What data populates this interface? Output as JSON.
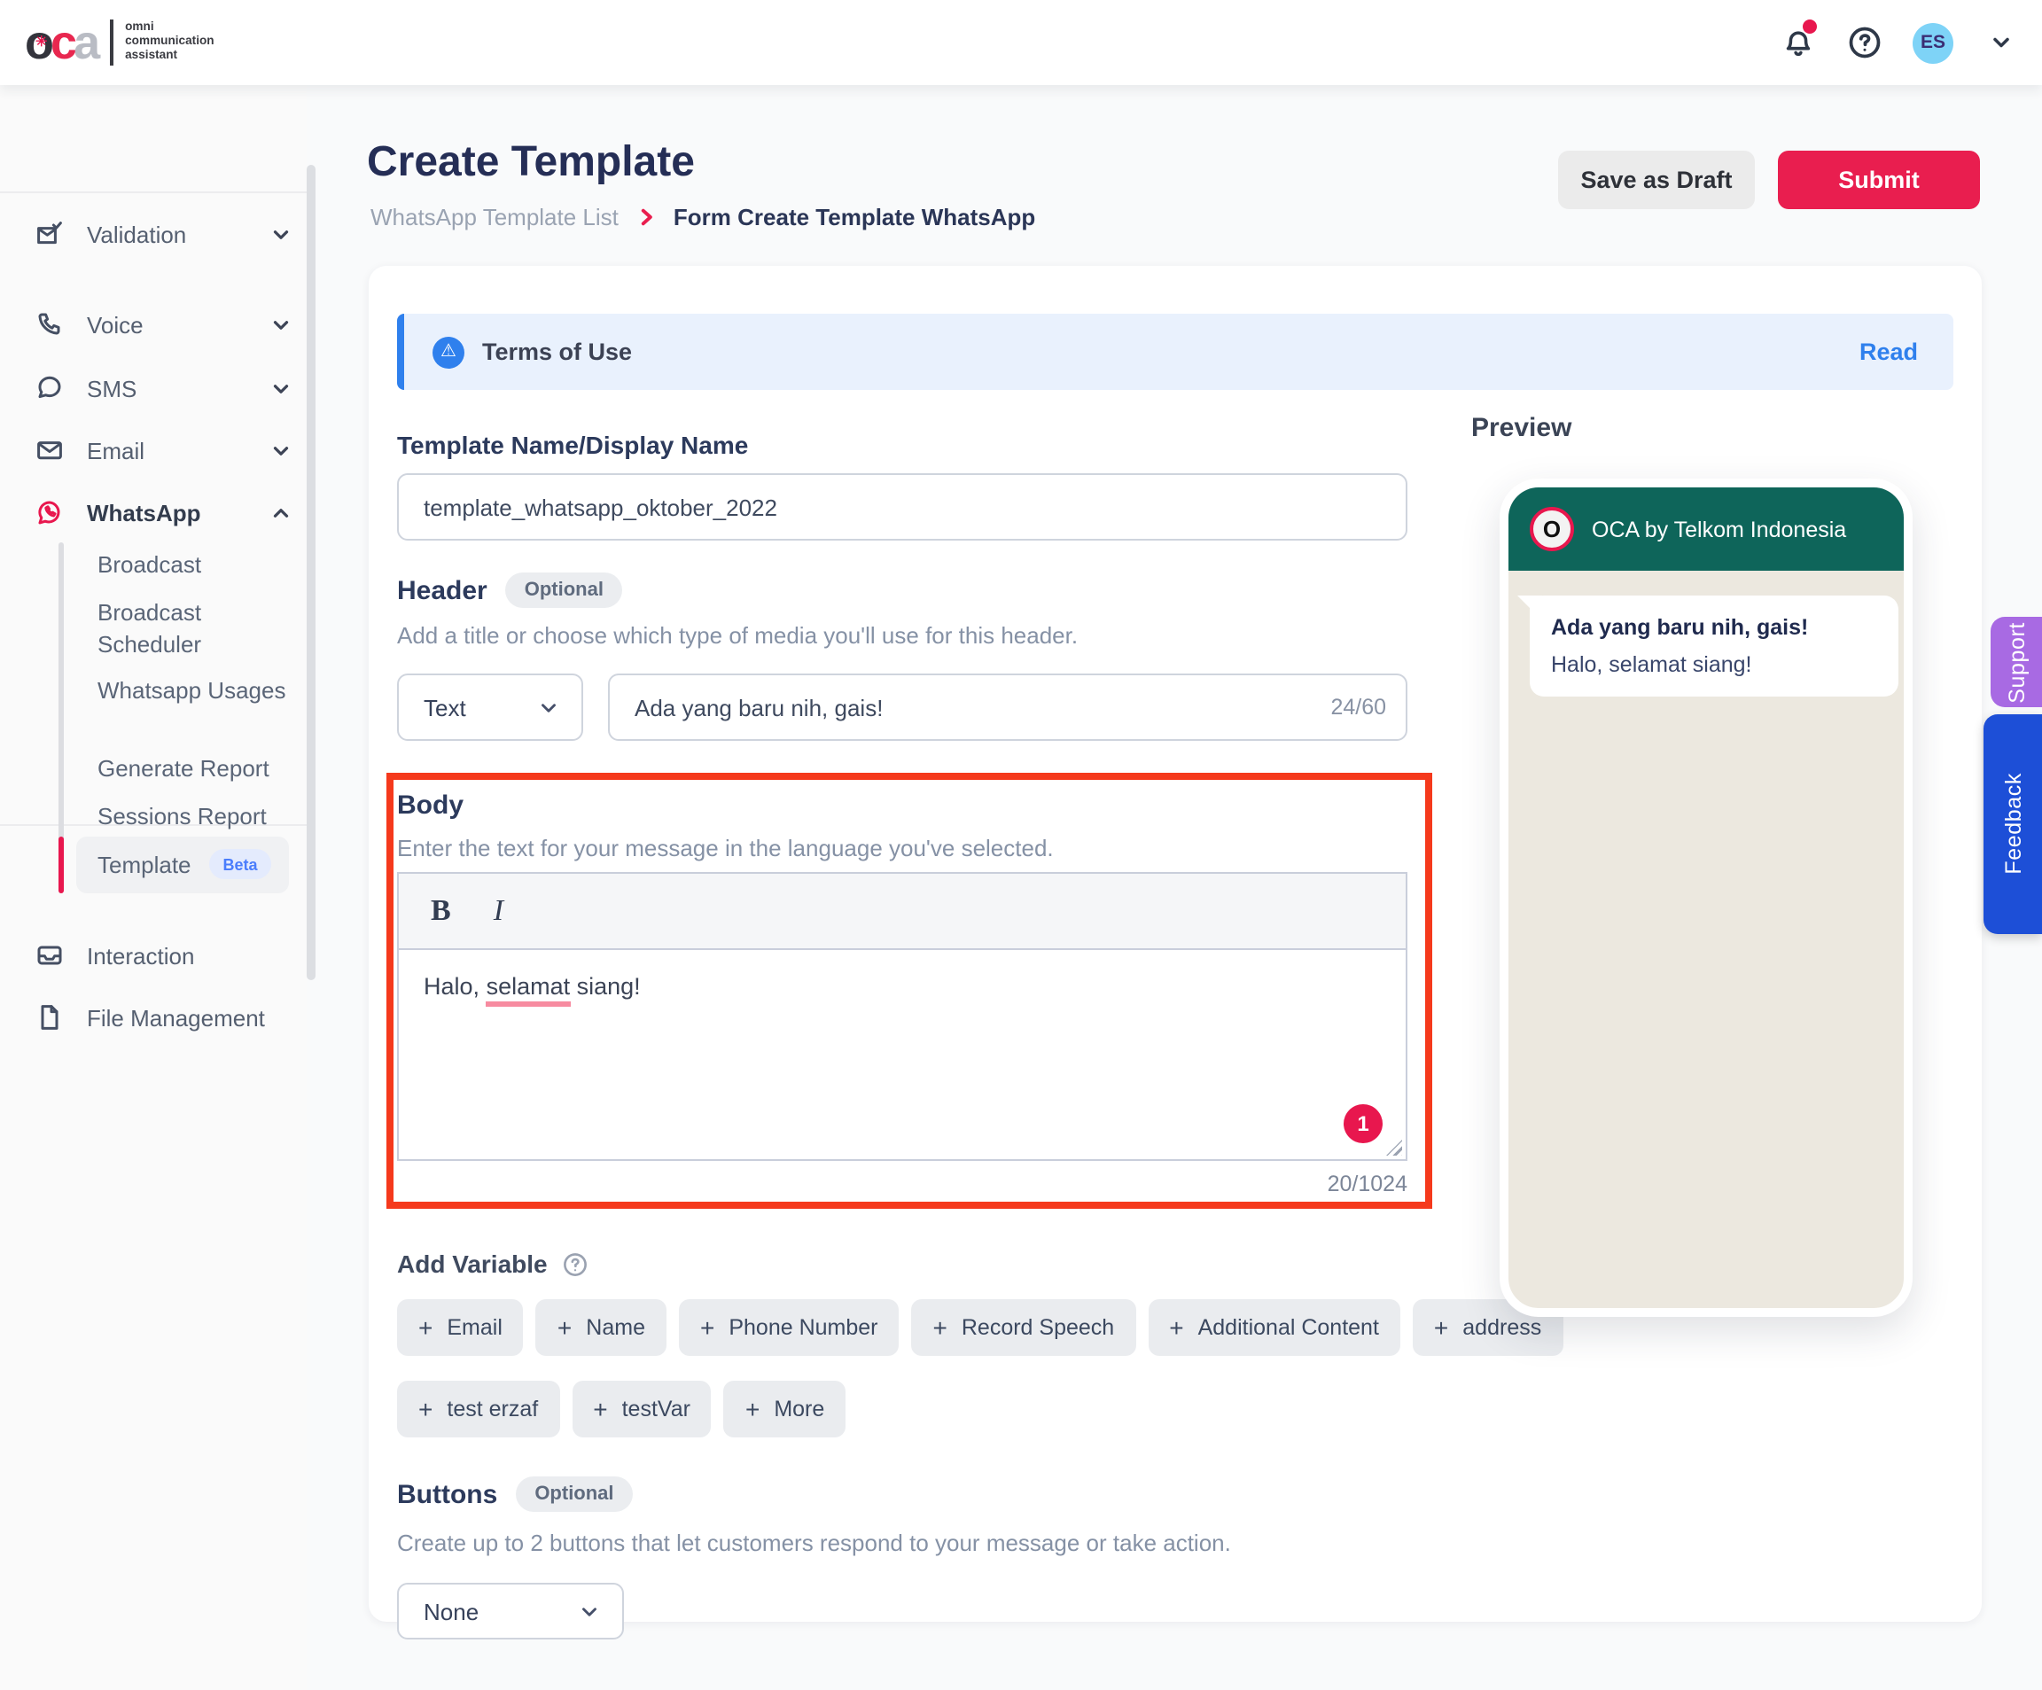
{
  "topbar": {
    "logo_word": {
      "o": "o",
      "c": "c",
      "a": "a"
    },
    "logo_tagline": [
      "omni",
      "communication",
      "assistant"
    ],
    "avatar_initials": "ES"
  },
  "sidebar": {
    "items": [
      {
        "label": "Validation"
      },
      {
        "label": "Voice"
      },
      {
        "label": "SMS"
      },
      {
        "label": "Email"
      },
      {
        "label": "WhatsApp"
      },
      {
        "label": "Interaction"
      },
      {
        "label": "File Management"
      }
    ],
    "whatsapp_children": [
      {
        "label": "Broadcast"
      },
      {
        "label": "Broadcast Scheduler"
      },
      {
        "label": "Whatsapp Usages"
      },
      {
        "label": "Generate Report"
      },
      {
        "label": "Sessions Report"
      },
      {
        "label": "Template"
      }
    ],
    "beta_badge": "Beta"
  },
  "page": {
    "title": "Create Template",
    "breadcrumb_parent": "WhatsApp Template List",
    "breadcrumb_current": "Form Create Template WhatsApp",
    "save_draft_label": "Save as Draft",
    "submit_label": "Submit"
  },
  "terms": {
    "label": "Terms of Use",
    "action": "Read",
    "icon_glyph": "⚠"
  },
  "form": {
    "template_name": {
      "label": "Template Name/Display Name",
      "value": "template_whatsapp_oktober_2022"
    },
    "header": {
      "title": "Header",
      "badge": "Optional",
      "helper": "Add a title or choose which type of media you'll use for this header.",
      "type_value": "Text",
      "text_value": "Ada yang baru nih, gais!",
      "counter": "24/60"
    },
    "body": {
      "title": "Body",
      "helper": "Enter the text for your message in the language you've selected.",
      "bold_label": "B",
      "italic_label": "I",
      "text_prefix": "Halo, ",
      "text_misspelled": "selamat",
      "text_suffix": " siang!",
      "counter": "20/1024",
      "badge": "1"
    },
    "add_variable": {
      "label": "Add Variable",
      "chips": [
        "Email",
        "Name",
        "Phone Number",
        "Record Speech",
        "Additional Content",
        "address",
        "test erzaf",
        "testVar",
        "More"
      ]
    },
    "buttons": {
      "title": "Buttons",
      "badge": "Optional",
      "helper": "Create up to 2 buttons that let customers respond to your message or take action.",
      "value": "None"
    }
  },
  "preview": {
    "title": "Preview",
    "chat_name": "OCA by Telkom Indonesia",
    "avatar_letter": "O",
    "message_title": "Ada yang baru nih, gais!",
    "message_body": "Halo, selamat siang!"
  },
  "edge_tabs": {
    "support": "Support",
    "feedback": "Feedback"
  },
  "colors": {
    "accent_pink": "#e91e4f",
    "teal_header": "#0e655a",
    "banner_blue": "#2f80ed",
    "red_frame": "#f5391c",
    "support_purple": "#a86ae3",
    "feedback_blue": "#1d4fd7"
  }
}
